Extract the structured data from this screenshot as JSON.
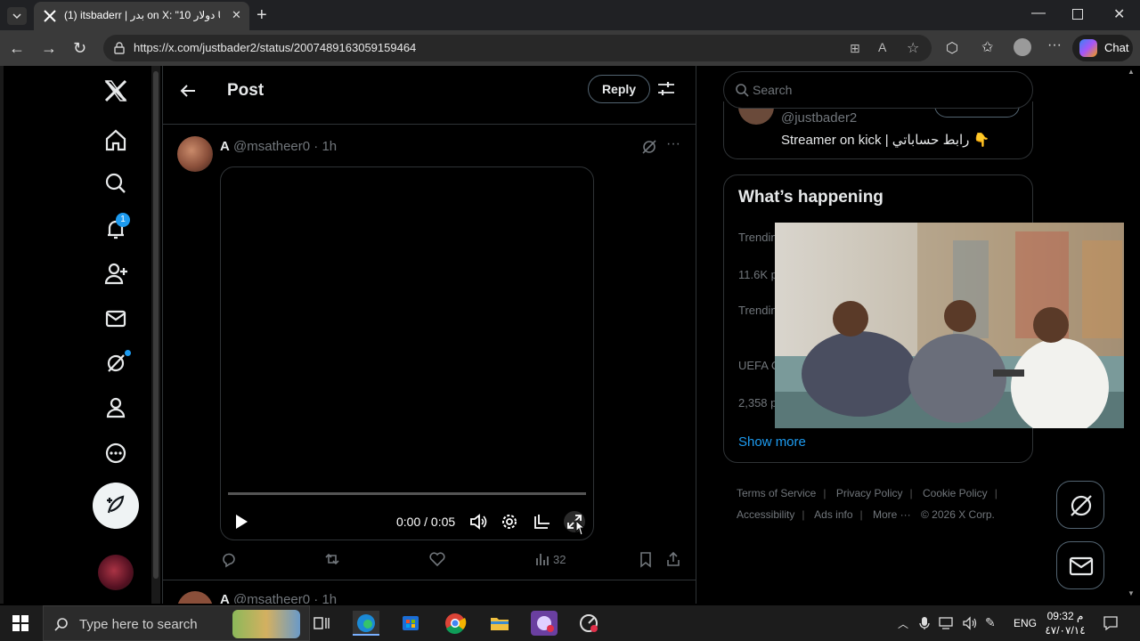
{
  "browser": {
    "tab_title": "(1) itsbaderr | بدر on X: \"10 دولار U",
    "url": "https://x.com/justbader2/status/2007489163059159464",
    "chat_label": "Chat"
  },
  "sidebar": {
    "notifications_badge": "1",
    "items": [
      "x-logo",
      "home",
      "explore",
      "notifications",
      "follow",
      "messages",
      "grok",
      "profile",
      "more"
    ]
  },
  "post": {
    "header_title": "Post",
    "reply_label": "Reply",
    "author_name": "A",
    "author_handle": "@msatheer0 · 1h",
    "video_time": "0:00 / 0:05",
    "view_count": "32",
    "video_progress": 0,
    "next_author_name": "A",
    "next_author_handle": "@msatheer0 · 1h"
  },
  "right": {
    "search_placeholder": "Search",
    "who_to_follow_handle": "@justbader2",
    "who_to_follow_bio": "Streamer on kick | رابط حساباتي 👇",
    "happening_title": "What’s happening",
    "trends": [
      {
        "label": "Trendin"
      },
      {
        "label": "11.6K p"
      },
      {
        "label": "Trendin"
      },
      {
        "label": "UEFA C"
      },
      {
        "label": "2,358 p"
      }
    ],
    "show_more": "Show more"
  },
  "footer": {
    "links": [
      "Terms of Service",
      "Privacy Policy",
      "Cookie Policy",
      "Accessibility",
      "Ads info",
      "More ···"
    ],
    "copyright": "© 2026 X Corp."
  },
  "taskbar": {
    "search_placeholder": "Type here to search",
    "language": "ENG",
    "time": "09:32 م",
    "date": "٤٧/٠٧/١٤"
  },
  "colors": {
    "accent": "#1d9bf0",
    "background": "#000000",
    "border": "#2f3336",
    "muted_text": "#71767b"
  }
}
